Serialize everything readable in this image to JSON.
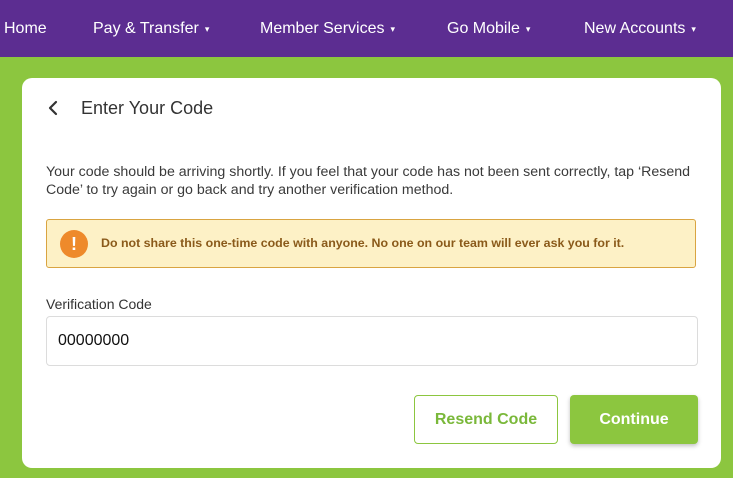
{
  "nav": {
    "home": "Home",
    "pay_transfer": "Pay & Transfer",
    "member_services": "Member Services",
    "go_mobile": "Go Mobile",
    "new_accounts": "New Accounts",
    "caret": "▾"
  },
  "page": {
    "title": "Enter Your Code",
    "description": "Your code should be arriving shortly. If you feel that your code has not been sent correctly, tap ‘Resend Code’ to try again or go back and try another verification method."
  },
  "warning": {
    "icon": "exclamation-icon",
    "icon_glyph": "!",
    "text": "Do not share this one-time code with anyone. No one on our team will ever ask you for it."
  },
  "form": {
    "label": "Verification Code",
    "value": "00000000"
  },
  "buttons": {
    "resend": "Resend Code",
    "continue": "Continue"
  },
  "colors": {
    "nav_bg": "#5c2d91",
    "page_bg": "#8cc63f",
    "accent_green": "#8cc63f",
    "warning_bg": "#fdf1c6",
    "warning_border": "#d9a441",
    "warning_icon": "#ee8a2b"
  }
}
